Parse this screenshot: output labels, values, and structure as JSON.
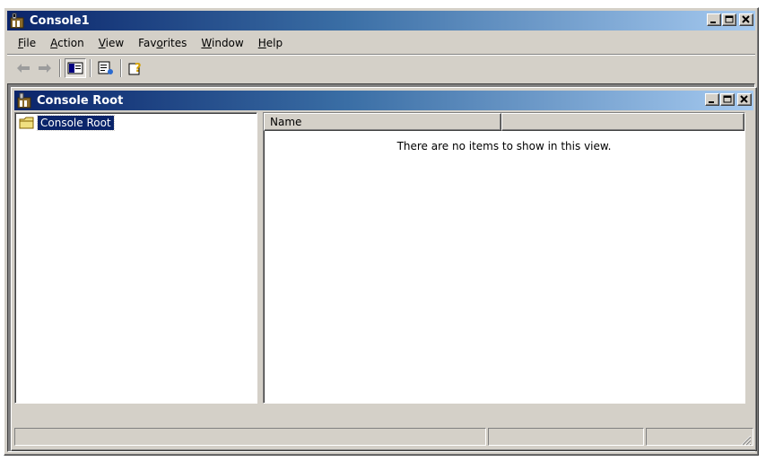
{
  "window": {
    "title": "Console1"
  },
  "menu": [
    "File",
    "Action",
    "View",
    "Favorites",
    "Window",
    "Help"
  ],
  "menu_access_keys": [
    "F",
    "A",
    "V",
    "o",
    "W",
    "H"
  ],
  "toolbar": {
    "back_icon": "back-arrow-icon",
    "forward_icon": "forward-arrow-icon",
    "show_hide_tree_icon": "show-hide-console-tree-icon",
    "export_list_icon": "export-list-icon",
    "help_icon": "help-icon"
  },
  "child_window": {
    "title": "Console Root"
  },
  "tree": {
    "root_label": "Console Root"
  },
  "list": {
    "columns": [
      "Name",
      ""
    ],
    "empty_message": "There are no items to show in this view."
  },
  "statusbar": {
    "panels": [
      "",
      "",
      ""
    ]
  },
  "colors": {
    "titlebar_start": "#0a246a",
    "titlebar_end": "#a6caf0",
    "face": "#d4d0c8",
    "selection": "#0a246a"
  }
}
